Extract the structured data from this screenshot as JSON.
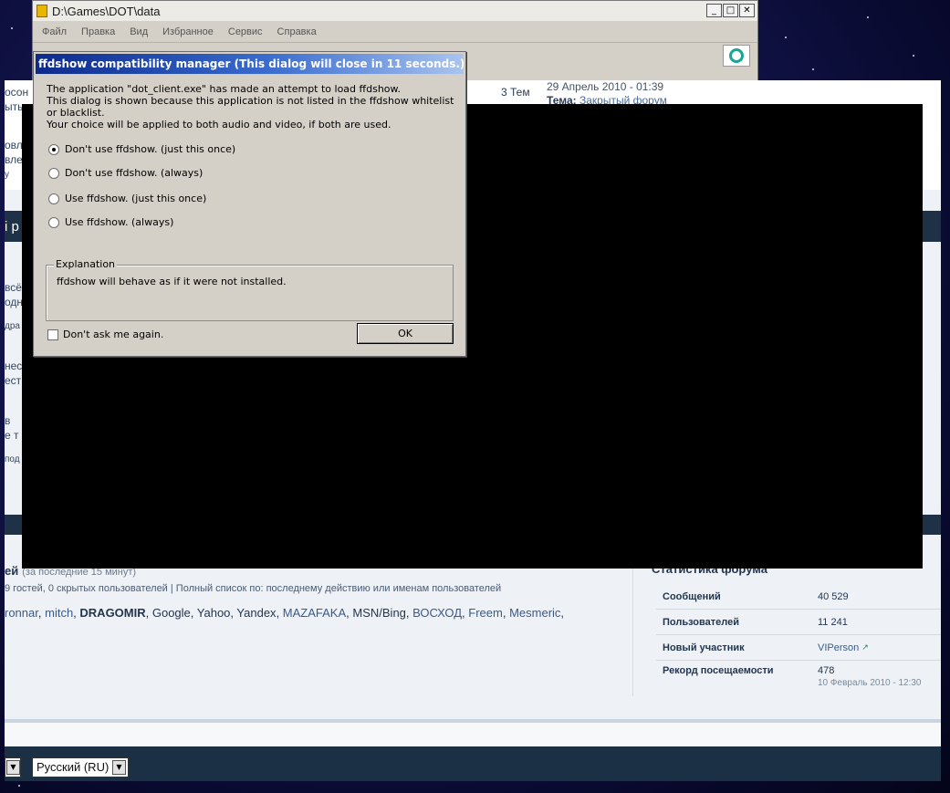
{
  "explorer": {
    "title": "D:\\Games\\DOT\\data",
    "menu": [
      "Файл",
      "Правка",
      "Вид",
      "Избранное",
      "Сервис",
      "Справка"
    ]
  },
  "forum": {
    "post_date": "29 Апрель 2010 - 01:39",
    "post_topic_label": "Тема:",
    "post_topic": "Закрытый форум",
    "topics_count": "3 Тем",
    "side_fragments": [
      "осон",
      "ыты",
      "овл",
      "вле",
      "у",
      "i p",
      "всё",
      "одн",
      "дра",
      "нес",
      "ест",
      "в",
      "е т",
      "под"
    ],
    "online_title": "ей",
    "online_subtitle": "(за последние 15 минут)",
    "online_counts": "9 гостей, 0 скрытых пользователей | Полный список по: последнему действию или именам пользователей",
    "online_users": [
      {
        "name": "ronnar",
        "style": "link"
      },
      {
        "name": "mitch",
        "style": "link"
      },
      {
        "name": "DRAGOMIR",
        "style": "bold"
      },
      {
        "name": "Google",
        "style": "plain"
      },
      {
        "name": "Yahoo",
        "style": "plain"
      },
      {
        "name": "Yandex",
        "style": "plain"
      },
      {
        "name": "MAZAFAKA",
        "style": "link"
      },
      {
        "name": "MSN/Bing",
        "style": "plain"
      },
      {
        "name": "ВОСХОД",
        "style": "link"
      },
      {
        "name": "Freem",
        "style": "link"
      },
      {
        "name": "Mesmeric",
        "style": "link"
      }
    ],
    "stats_title": "Статистика форума",
    "stats": {
      "messages_label": "Сообщений",
      "messages_value": "40 529",
      "users_label": "Пользователей",
      "users_value": "11 241",
      "newest_label": "Новый участник",
      "newest_value": "VIPerson",
      "record_label": "Рекорд посещаемости",
      "record_value": "478",
      "record_date": "10 Февраль 2010 - 12:30"
    },
    "language_select": "Русский (RU)"
  },
  "dialog": {
    "title": "ffdshow compatibility manager   (This dialog will close in 11 seconds.)",
    "message_line1": "The application \"dot_client.exe\" has made an attempt to load ffdshow.",
    "message_line2": "This dialog is shown because this application is not listed in the ffdshow whitelist or blacklist.",
    "message_line3": "Your choice will be applied to both audio and video, if both are used.",
    "options": [
      {
        "label": "Don't use ffdshow. (just this once)",
        "checked": true
      },
      {
        "label": "Don't use ffdshow. (always)",
        "checked": false
      },
      {
        "label": "Use ffdshow. (just this once)",
        "checked": false
      },
      {
        "label": "Use ffdshow. (always)",
        "checked": false
      }
    ],
    "explanation_title": "Explanation",
    "explanation_text": "ffdshow will behave as if it were not installed.",
    "dont_ask_label": "Don't ask me again.",
    "dont_ask_checked": false,
    "ok_label": "OK"
  }
}
